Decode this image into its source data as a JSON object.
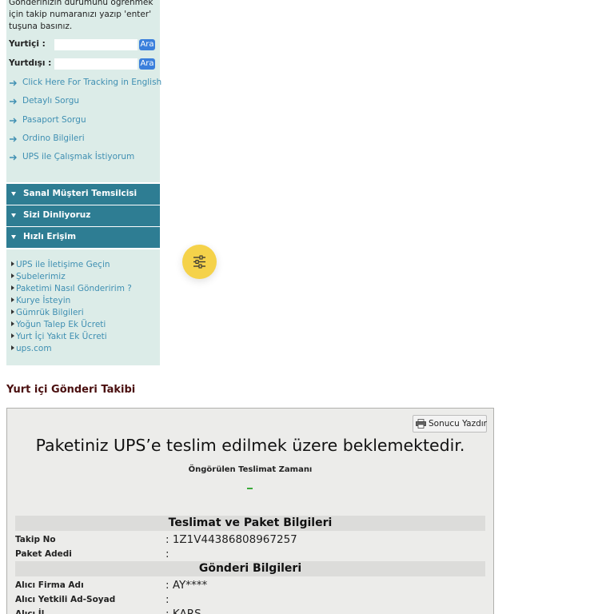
{
  "sidebar": {
    "intro_text": "Gönderinizin durumunu öğrenmek için takip numaranızı yazıp 'enter' tuşuna basınız.",
    "domestic": {
      "label": "Yurtiçi :",
      "value": "",
      "button": "Ara"
    },
    "international": {
      "label": "Yurtdışı :",
      "value": "",
      "button": "Ara"
    },
    "links": [
      {
        "label": "Click Here For Tracking in English"
      },
      {
        "label": "Detaylı Sorgu"
      },
      {
        "label": "Pasaport Sorgu"
      },
      {
        "label": "Ordino Bilgileri"
      },
      {
        "label": "UPS ile Çalışmak İstiyorum"
      }
    ],
    "accordions": [
      {
        "label": "Sanal Müşteri Temsilcisi"
      },
      {
        "label": "Sizi Dinliyoruz"
      },
      {
        "label": "Hızlı Erişim"
      }
    ],
    "quick_links": [
      {
        "label": "UPS ile İletişime Geçin"
      },
      {
        "label": "Şubelerimiz"
      },
      {
        "label": "Paketimi Nasıl Gönderirim ?"
      },
      {
        "label": "Kurye İsteyin"
      },
      {
        "label": "Gümrük Bilgileri"
      },
      {
        "label": "Yoğun Talep Ek Ücreti"
      },
      {
        "label": "Yurt İçi Yakıt Ek Ücreti"
      },
      {
        "label": "ups.com"
      }
    ]
  },
  "fab": {
    "icon": "sliders-icon"
  },
  "main": {
    "section_title": "Yurt içi Gönderi Takibi",
    "print_button": "Sonucu Yazdır",
    "status_headline": "Paketiniz UPS’e teslim edilmek üzere beklemektedir.",
    "eta_label": "Öngörülen Teslimat Zamanı",
    "eta_value": "-",
    "sections": [
      {
        "title": "Teslimat ve Paket Bilgileri",
        "rows": [
          {
            "key": "Takip No",
            "value": ": 1Z1V44386808967257"
          },
          {
            "key": "Paket Adedi",
            "value": ":"
          }
        ]
      },
      {
        "title": "Gönderi Bilgileri",
        "rows": [
          {
            "key": "Alıcı Firma Adı",
            "value": ": AY****"
          },
          {
            "key": "Alıcı Yetkili Ad-Soyad",
            "value": ":"
          },
          {
            "key": "Alıcı İl",
            "value": ": KARS"
          }
        ]
      }
    ]
  },
  "colors": {
    "panel_bg": "#dcece8",
    "accordion_bg": "#2e7d93",
    "link": "#3f8fb2",
    "search_button": "#3a7fdc",
    "fab": "#f5d24a",
    "section_title": "#4a0f0f"
  }
}
